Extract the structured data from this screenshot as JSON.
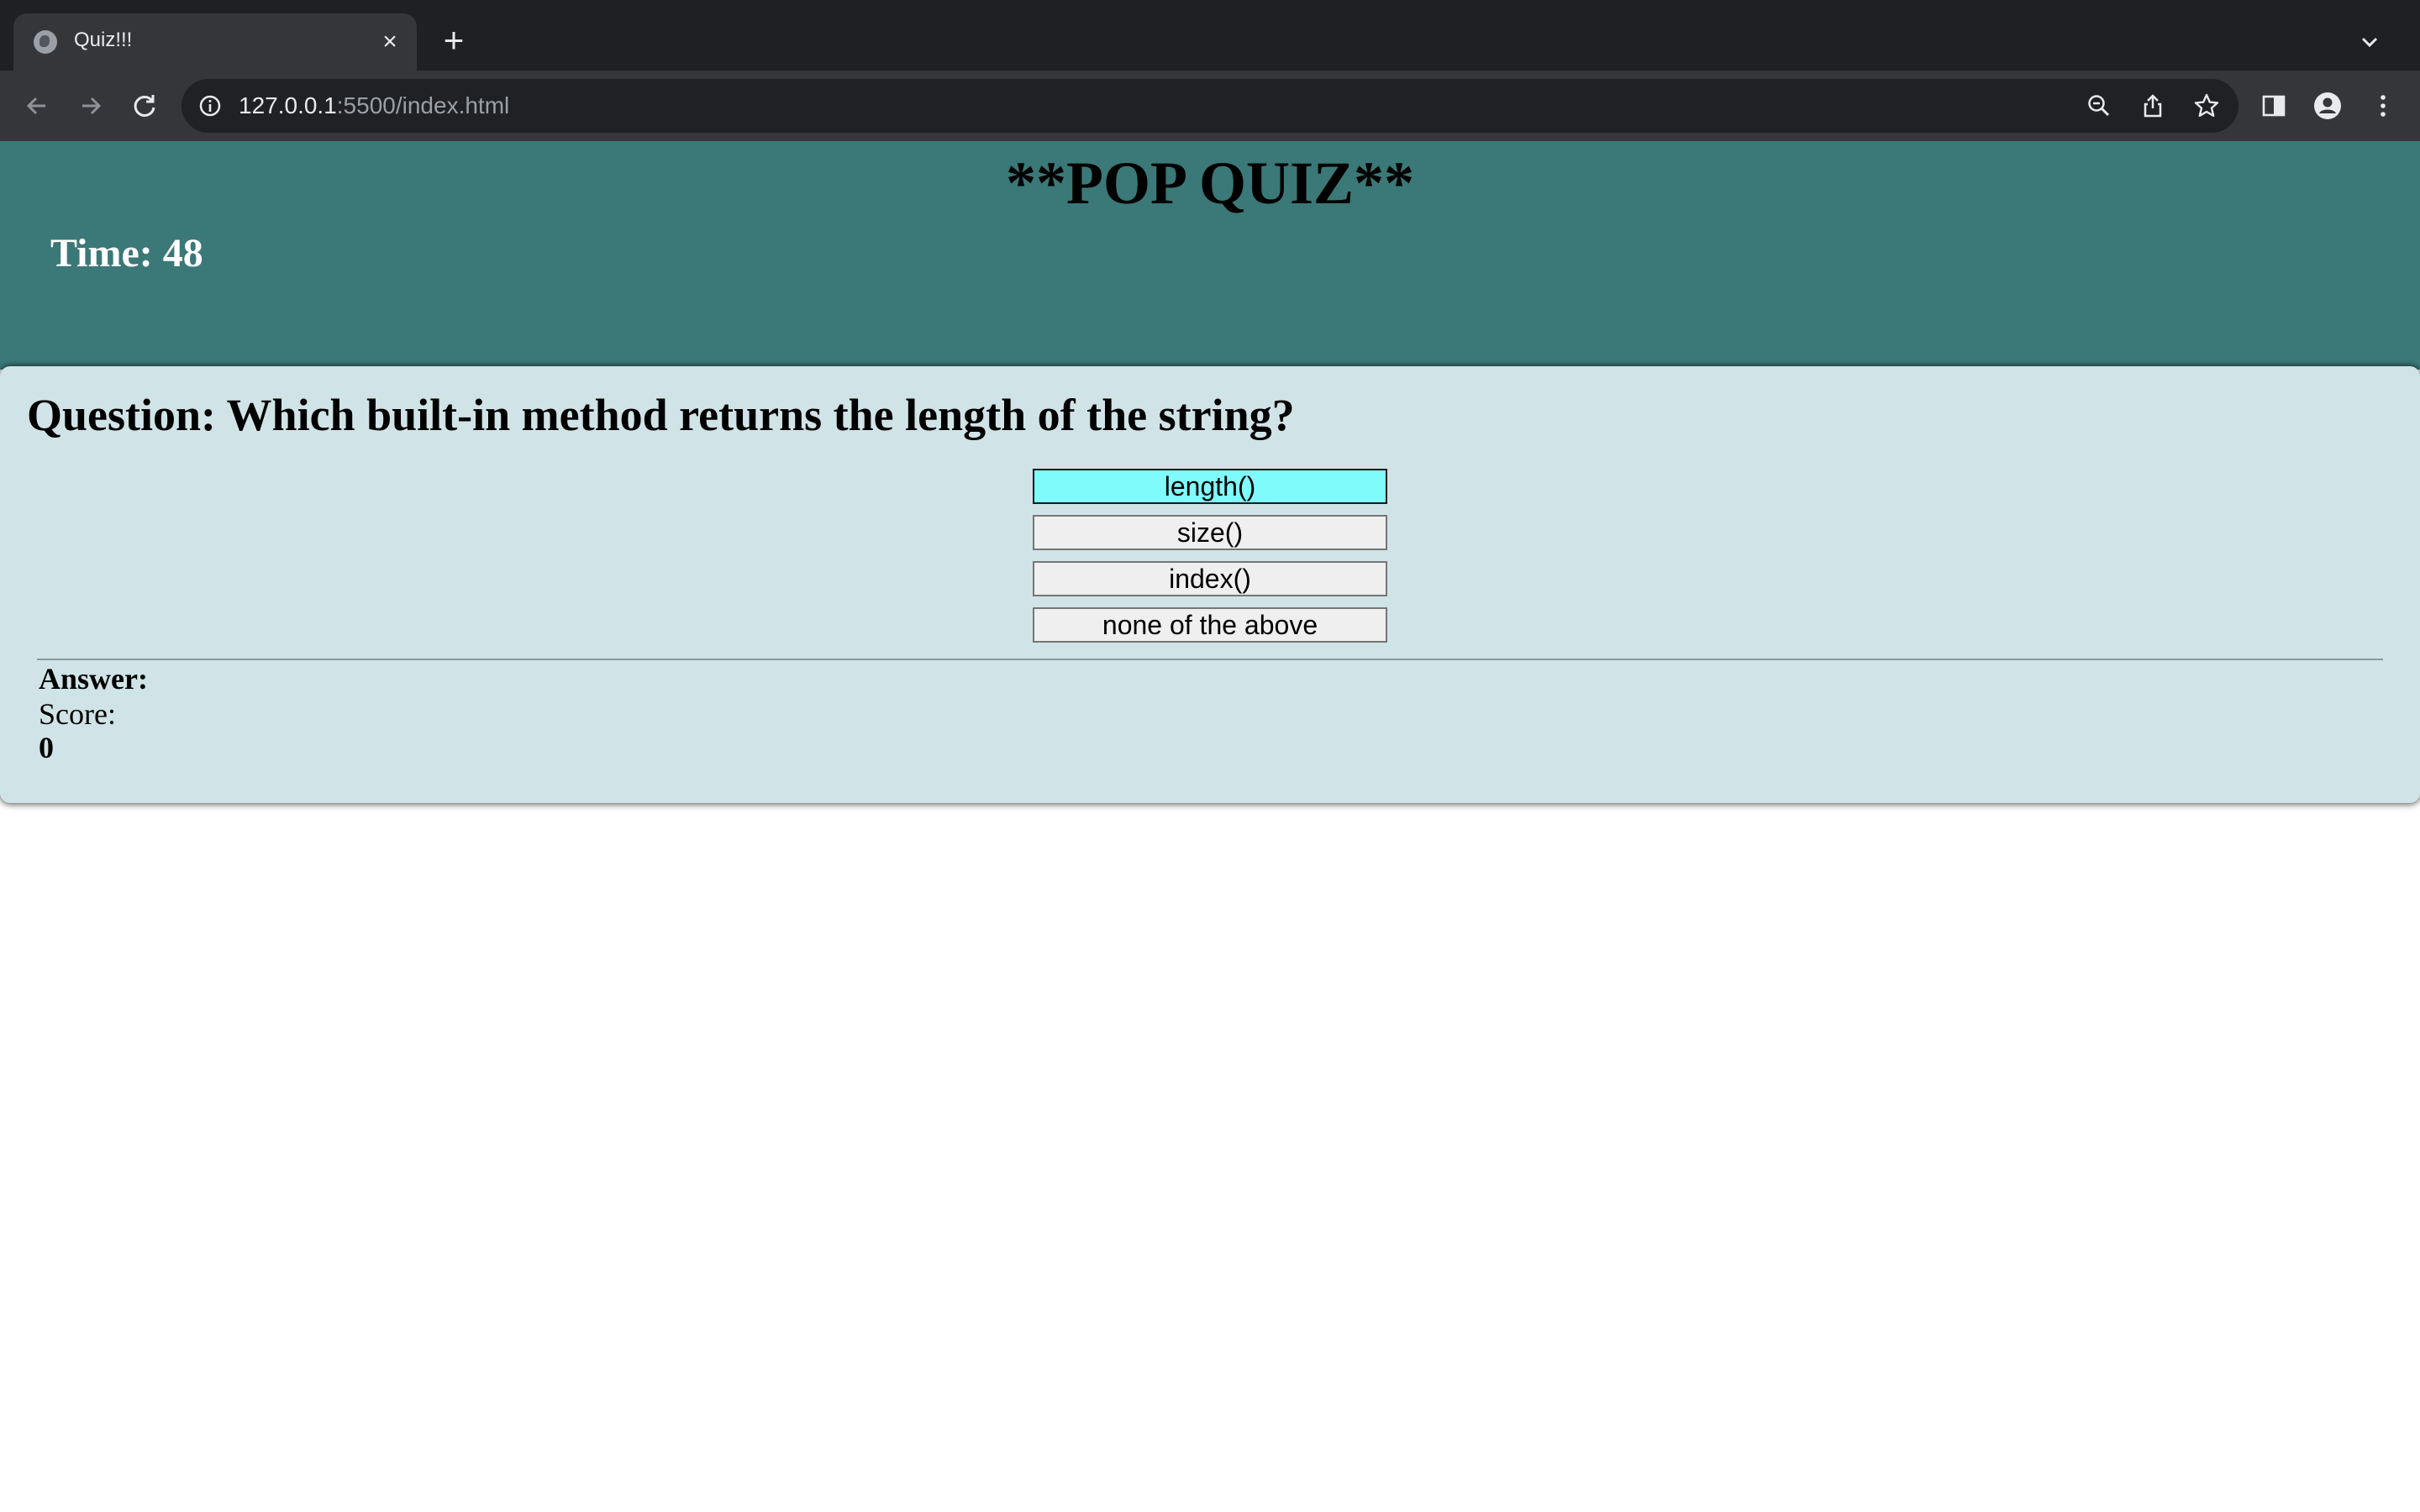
{
  "browser": {
    "tab_title": "Quiz!!!",
    "url_host": "127.0.0.1",
    "url_rest": ":5500/index.html"
  },
  "page": {
    "title": "**POP QUIZ**",
    "timer_label": "Time: 48",
    "question": "Question: Which built-in method returns the length of the string?",
    "choices": [
      "length()",
      "size()",
      "index()",
      "none of the above"
    ],
    "highlighted_choice": "length()",
    "answer_label": "Answer:",
    "score_label": "Score:",
    "score_value": "0"
  },
  "colors": {
    "header_bg": "#3b7878",
    "card_bg": "#d0e3e7",
    "choice_highlight": "#7ffbfb"
  }
}
